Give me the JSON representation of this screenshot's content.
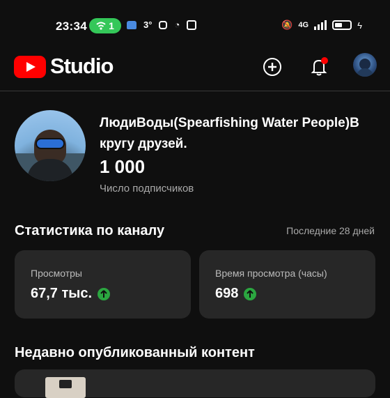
{
  "status_bar": {
    "time": "23:34",
    "hotspot_count": "1",
    "temperature": "3°",
    "network": "4G"
  },
  "header": {
    "app_name": "Studio",
    "icons": [
      "youtube-logo",
      "create-icon",
      "notifications-icon",
      "account-avatar"
    ]
  },
  "channel": {
    "name": "ЛюдиВоды(Spearfishing Water People)В кругу друзей.",
    "subscribers": "1 000",
    "subscribers_label": "Число подписчиков"
  },
  "stats": {
    "title": "Статистика по каналу",
    "period": "Последние 28 дней",
    "cards": [
      {
        "label": "Просмотры",
        "value": "67,7 тыс.",
        "trend": "up"
      },
      {
        "label": "Время просмотра (часы)",
        "value": "698",
        "trend": "up"
      }
    ]
  },
  "recent": {
    "title": "Недавно опубликованный контент"
  },
  "colors": {
    "background": "#0f0f0f",
    "card": "#272727",
    "brand_red": "#ff0000",
    "trend_green": "#2ba640",
    "notification_dot": "#ff0000"
  }
}
